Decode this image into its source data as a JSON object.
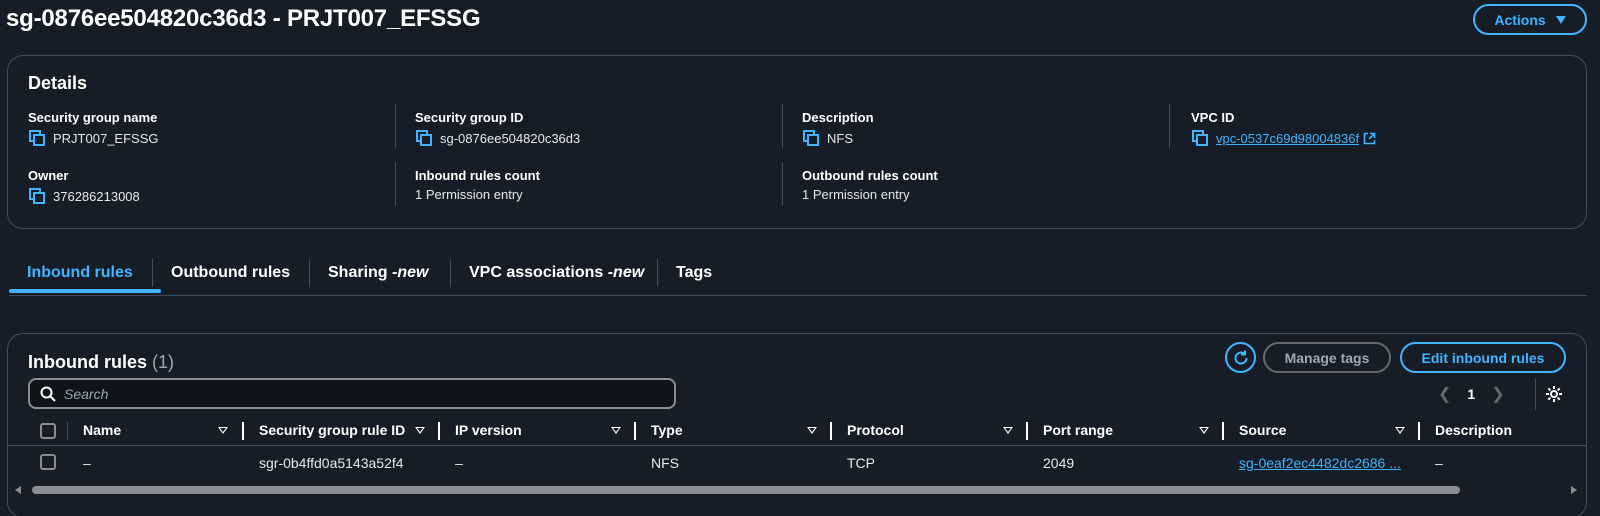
{
  "header": {
    "title": "sg-0876ee504820c36d3 - PRJT007_EFSSG",
    "actions_label": "Actions"
  },
  "details": {
    "heading": "Details",
    "fields": {
      "sg_name": {
        "label": "Security group name",
        "value": "PRJT007_EFSSG"
      },
      "sg_id": {
        "label": "Security group ID",
        "value": "sg-0876ee504820c36d3"
      },
      "description": {
        "label": "Description",
        "value": "NFS"
      },
      "vpc_id": {
        "label": "VPC ID",
        "value": "vpc-0537c69d98004836f"
      },
      "owner": {
        "label": "Owner",
        "value": "376286213008"
      },
      "inbound_count": {
        "label": "Inbound rules count",
        "value": "1 Permission entry"
      },
      "outbound_count": {
        "label": "Outbound rules count",
        "value": "1 Permission entry"
      }
    }
  },
  "tabs": [
    {
      "label": "Inbound rules",
      "suffix": "",
      "active": true
    },
    {
      "label": "Outbound rules",
      "suffix": "",
      "active": false
    },
    {
      "label": "Sharing - ",
      "suffix": "new",
      "active": false
    },
    {
      "label": "VPC associations - ",
      "suffix": "new",
      "active": false
    },
    {
      "label": "Tags",
      "suffix": "",
      "active": false
    }
  ],
  "rules": {
    "heading": "Inbound rules",
    "count": "(1)",
    "manage_tags_label": "Manage tags",
    "edit_label": "Edit inbound rules",
    "search_placeholder": "Search",
    "page": "1",
    "columns": [
      "Name",
      "Security group rule ID",
      "IP version",
      "Type",
      "Protocol",
      "Port range",
      "Source",
      "Description"
    ],
    "rows": [
      {
        "name": "–",
        "rule_id": "sgr-0b4ffd0a5143a52f4",
        "ip_version": "–",
        "type": "NFS",
        "protocol": "TCP",
        "port_range": "2049",
        "source": "sg-0eaf2ec4482dc2686 ...",
        "description": "–"
      }
    ]
  },
  "colors": {
    "background": "#161d26",
    "accent": "#42b4ff",
    "border": "#414d5c"
  }
}
